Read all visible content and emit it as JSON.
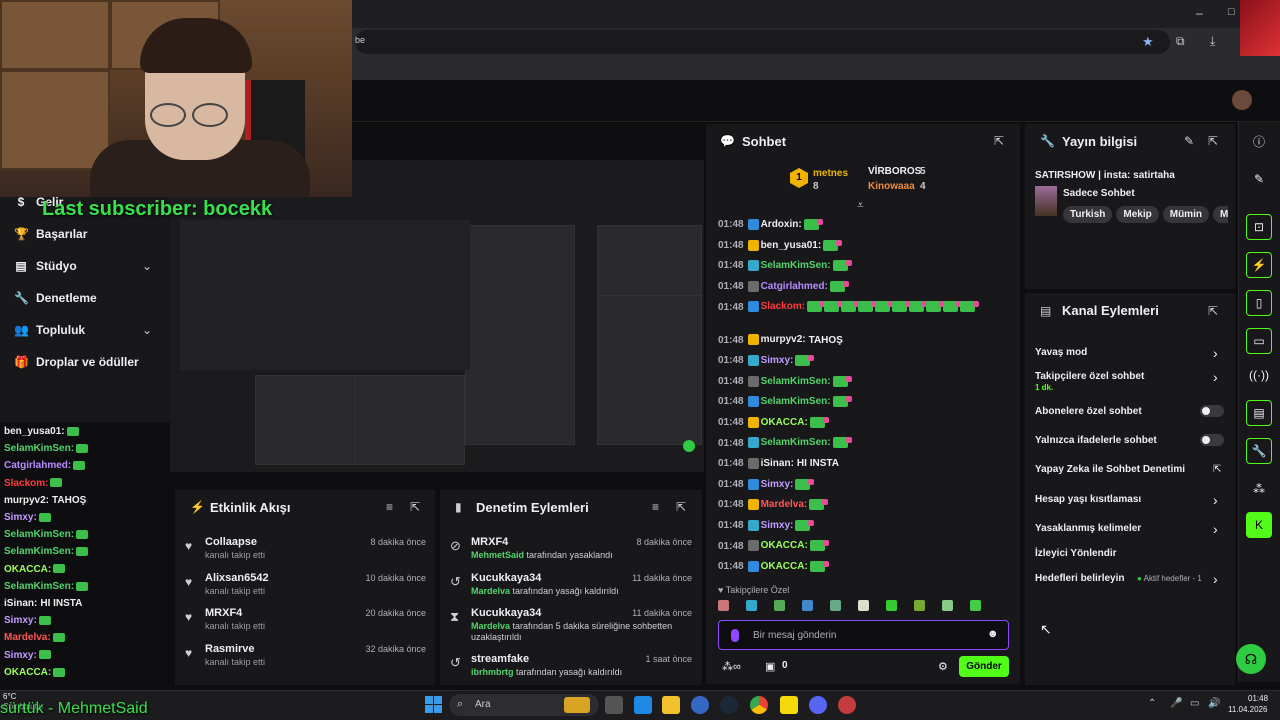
{
  "browser": {
    "address_suffix": "be"
  },
  "nav": {
    "items": [
      {
        "label": "Gelir"
      },
      {
        "label": "Başarılar"
      },
      {
        "label": "Stüdyo"
      },
      {
        "label": "Denetleme"
      },
      {
        "label": "Topluluk"
      },
      {
        "label": "Droplar ve ödüller"
      }
    ]
  },
  "overlay": {
    "last_subscriber": "Last subscriber: bocekk",
    "bottom_text": "sürtük - MehmetSaid"
  },
  "left_chat": [
    {
      "user": "ben_yusa01:",
      "color": "#efeff1",
      "text": ""
    },
    {
      "user": "SelamKimSen:",
      "color": "#52d46b",
      "text": ""
    },
    {
      "user": "Catgirlahmed:",
      "color": "#b98bff",
      "text": ""
    },
    {
      "user": "Slackom:",
      "color": "#ff3b3b",
      "text": ""
    },
    {
      "user": "murpyv2:",
      "color": "#efeff1",
      "text": "TAHOŞ"
    },
    {
      "user": "Simxy:",
      "color": "#c29bff",
      "text": ""
    },
    {
      "user": "SelamKimSen:",
      "color": "#52d46b",
      "text": ""
    },
    {
      "user": "SelamKimSen:",
      "color": "#52d46b",
      "text": ""
    },
    {
      "user": "OKACCA:",
      "color": "#9aff5a",
      "text": ""
    },
    {
      "user": "SelamKimSen:",
      "color": "#52d46b",
      "text": ""
    },
    {
      "user": "iSinan:",
      "color": "#efeff1",
      "text": "HI INSTA"
    },
    {
      "user": "Simxy:",
      "color": "#c29bff",
      "text": ""
    },
    {
      "user": "Mardelva:",
      "color": "#ff5555",
      "text": ""
    },
    {
      "user": "Simxy:",
      "color": "#c29bff",
      "text": ""
    },
    {
      "user": "OKACCA:",
      "color": "#9aff5a",
      "text": ""
    }
  ],
  "activity": {
    "title": "Etkinlik Akışı",
    "items": [
      {
        "name": "Collaapse",
        "sub": "kanalı takip etti",
        "time": "8 dakika önce"
      },
      {
        "name": "Alixsan6542",
        "sub": "kanalı takip etti",
        "time": "10 dakika önce"
      },
      {
        "name": "MRXF4",
        "sub": "kanalı takip etti",
        "time": "20 dakika önce"
      },
      {
        "name": "Rasmirve",
        "sub": "kanalı takip etti",
        "time": "32 dakika önce"
      }
    ]
  },
  "modlog": {
    "title": "Denetim Eylemleri",
    "items": [
      {
        "name": "MRXF4",
        "mod": "MehmetSaid",
        "action": "tarafından yasaklandı",
        "action2": "",
        "time": "8 dakika önce",
        "icon": "ban-icon"
      },
      {
        "name": "Kucukkaya34",
        "mod": "Mardelva",
        "action": "tarafından yasağı kaldırıldı",
        "action2": "",
        "time": "11 dakika önce",
        "icon": "undo-icon"
      },
      {
        "name": "Kucukkaya34",
        "mod": "Mardelva",
        "action": "tarafından 5 dakika süreliğine sohbetten",
        "action2": "uzaklaştırıldı",
        "time": "11 dakika önce",
        "icon": "hourglass-icon"
      },
      {
        "name": "streamfake",
        "mod": "ibrhmbrtg",
        "action": "tarafından yasağı kaldırıldı",
        "action2": "",
        "time": "1 saat önce",
        "icon": "undo-icon"
      }
    ]
  },
  "chat": {
    "title": "Sohbet",
    "leaderboard": [
      {
        "rank": "1",
        "name": "metnes",
        "count": "8"
      },
      {
        "name": "VİRBOROS",
        "count": "5"
      },
      {
        "name": "Kinowaaa",
        "count": "4"
      }
    ],
    "messages": [
      {
        "time": "01:48",
        "user": "Ardoxin:",
        "color": "#efeff1",
        "text": "",
        "emotes": 1
      },
      {
        "time": "01:48",
        "user": "ben_yusa01:",
        "color": "#efeff1",
        "text": "",
        "emotes": 1
      },
      {
        "time": "01:48",
        "user": "SelamKimSen:",
        "color": "#52d46b",
        "text": "",
        "emotes": 1
      },
      {
        "time": "01:48",
        "user": "Catgirlahmed:",
        "color": "#b98bff",
        "text": "",
        "emotes": 1
      },
      {
        "time": "01:48",
        "user": "Slackom:",
        "color": "#ff3b3b",
        "text": "",
        "emotes": 10
      },
      {
        "time": "01:48",
        "user": "murpyv2:",
        "color": "#efeff1",
        "text": "TAHOŞ",
        "emotes": 0
      },
      {
        "time": "01:48",
        "user": "Simxy:",
        "color": "#c29bff",
        "text": "",
        "emotes": 1
      },
      {
        "time": "01:48",
        "user": "SelamKimSen:",
        "color": "#52d46b",
        "text": "",
        "emotes": 1
      },
      {
        "time": "01:48",
        "user": "SelamKimSen:",
        "color": "#52d46b",
        "text": "",
        "emotes": 1
      },
      {
        "time": "01:48",
        "user": "OKACCA:",
        "color": "#9aff5a",
        "text": "",
        "emotes": 1
      },
      {
        "time": "01:48",
        "user": "SelamKimSen:",
        "color": "#52d46b",
        "text": "",
        "emotes": 1
      },
      {
        "time": "01:48",
        "user": "iSinan:",
        "color": "#efeff1",
        "text": "HI INSTA",
        "emotes": 0
      },
      {
        "time": "01:48",
        "user": "Simxy:",
        "color": "#c29bff",
        "text": "",
        "emotes": 1
      },
      {
        "time": "01:48",
        "user": "Mardelva:",
        "color": "#ff5555",
        "text": "",
        "emotes": 1
      },
      {
        "time": "01:48",
        "user": "Simxy:",
        "color": "#c29bff",
        "text": "",
        "emotes": 1
      },
      {
        "time": "01:48",
        "user": "OKACCA:",
        "color": "#9aff5a",
        "text": "",
        "emotes": 1
      },
      {
        "time": "01:48",
        "user": "OKACCA:",
        "color": "#9aff5a",
        "text": "",
        "emotes": 1
      }
    ],
    "followers_only": "Takipçilere Özel",
    "input_placeholder": "Bir mesaj gönderin",
    "points": "0",
    "send_label": "Gönder"
  },
  "stream_info": {
    "title": "Yayın bilgisi",
    "stream_title": "SATIRSHOW | insta: satirtaha",
    "category": "Sadece Sohbet",
    "tags": [
      "Turkish",
      "Mekip",
      "Mümin",
      "Müs"
    ]
  },
  "channel_actions": {
    "title": "Kanal Eylemleri",
    "items": [
      {
        "label": "Yavaş mod",
        "sub": "",
        "control": "chevron"
      },
      {
        "label": "Takipçilere özel sohbet",
        "sub": "1 dk.",
        "control": "chevron"
      },
      {
        "label": "Abonelere özel sohbet",
        "sub": "",
        "control": "toggle"
      },
      {
        "label": "Yalnızca ifadelerle sohbet",
        "sub": "",
        "control": "toggle"
      },
      {
        "label": "Yapay Zeka ile Sohbet Denetimi",
        "sub": "",
        "control": "external"
      },
      {
        "label": "Hesap yaşı kısıtlaması",
        "sub": "",
        "control": "chevron"
      },
      {
        "label": "Yasaklanmış kelimeler",
        "sub": "",
        "control": "chevron"
      },
      {
        "label": "İzleyici Yönlendir",
        "sub": "",
        "control": "none"
      },
      {
        "label": "Hedefleri belirleyin",
        "sub": "",
        "control": "chevron",
        "status": "Aktif hedefler - 1"
      }
    ]
  },
  "taskbar": {
    "search_label": "Ara",
    "weather_temp": "6°C",
    "weather_desc": "Çok bulutlu",
    "time": "01:48",
    "date": "11.04.2026"
  },
  "colors": {
    "accent_green": "#53fc18",
    "purple": "#9147ff",
    "bg": "#0e0e10"
  }
}
